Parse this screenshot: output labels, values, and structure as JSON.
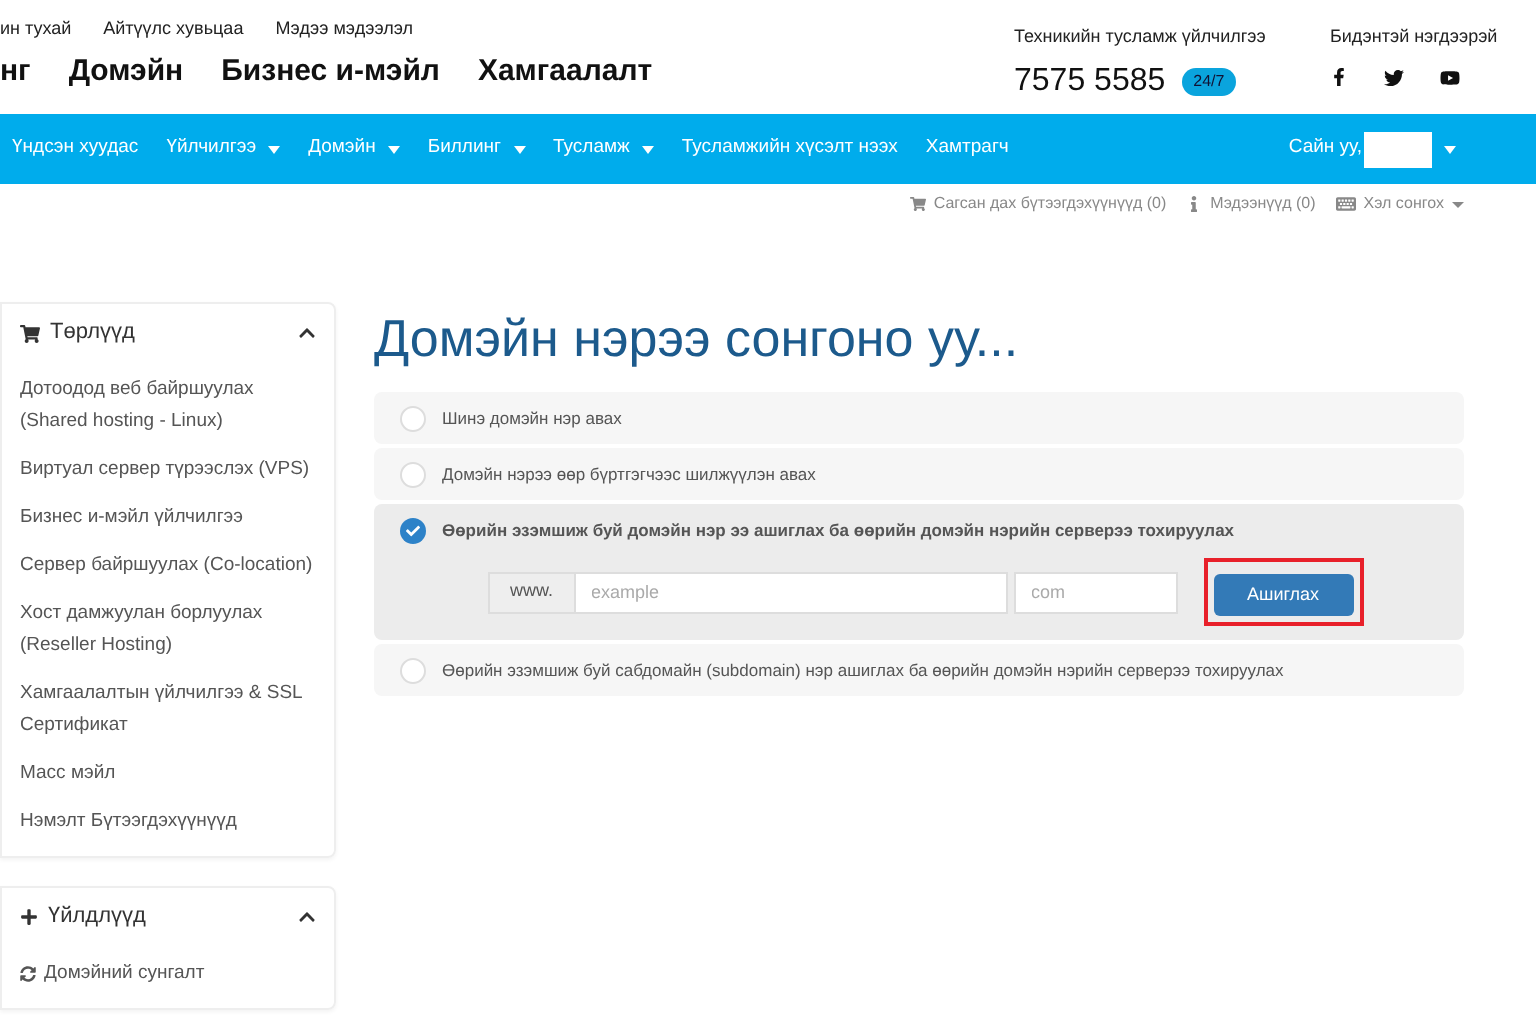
{
  "top_links": [
    "ин тухай",
    "Айтүүлс хувьцаа",
    "Мэдээ мэдээлэл"
  ],
  "main_menu": [
    "нг",
    "Домэйн",
    "Бизнес и-мэйл",
    "Хамгаалалт"
  ],
  "support": {
    "label": "Техникийн тусламж үйлчилгээ",
    "phone": "7575 5585",
    "badge": "24/7"
  },
  "social": {
    "label": "Бидэнтэй нэгдээрэй"
  },
  "navbar": {
    "items": [
      {
        "label": "Үндсэн хуудас",
        "dropdown": false
      },
      {
        "label": "Үйлчилгээ",
        "dropdown": true
      },
      {
        "label": "Домэйн",
        "dropdown": true
      },
      {
        "label": "Биллинг",
        "dropdown": true
      },
      {
        "label": "Тусламж",
        "dropdown": true
      },
      {
        "label": "Тусламжийн хүсэлт нээх",
        "dropdown": false
      },
      {
        "label": "Хамтрагч",
        "dropdown": false
      }
    ],
    "greeting": "Сайн уу,"
  },
  "utility": [
    "Сагсан дах бүтээгдэхүүнүүд (0)",
    "Мэдээнүүд (0)",
    "Хэл сонгох"
  ],
  "sidebar": [
    {
      "title": "Төрлүүд",
      "expanded": true,
      "items": [
        "Дотоодод веб байршуулах (Shared hosting - Linux)",
        "Виртуал сервер түрээслэх (VPS)",
        "Бизнес и-мэйл үйлчилгээ",
        "Сервер байршуулах (Co-location)",
        "Хост дамжуулан борлуулах (Reseller Hosting)",
        "Хамгаалалтын үйлчилгээ & SSL Сертификат",
        "Масс мэйл",
        "Нэмэлт Бүтээгдэхүүнүүд"
      ]
    },
    {
      "title": "Үйлдлүүд",
      "expanded": true,
      "items": [
        "Домэйний сунгалт"
      ]
    }
  ],
  "heading": "Домэйн нэрээ сонгоно уу...",
  "options": [
    {
      "label": "Шинэ домэйн нэр авах",
      "selected": false
    },
    {
      "label": "Домэйн нэрээ өөр бүртгэгчээс шилжүүлэн авах",
      "selected": false
    },
    {
      "label": "Өөрийн эзэмшиж буй домэйн нэр ээ ашиглах ба өөрийн домэйн нэрийн серверээ тохируулах",
      "selected": true
    },
    {
      "label": "Өөрийн эзэмшиж буй сабдомайн (subdomain) нэр ашиглах ба өөрийн домэйн нэрийн серверээ тохируулах",
      "selected": false
    }
  ],
  "domain_form": {
    "prefix": "www.",
    "name_placeholder": "example",
    "tld_placeholder": "com",
    "button": "Ашиглах"
  }
}
